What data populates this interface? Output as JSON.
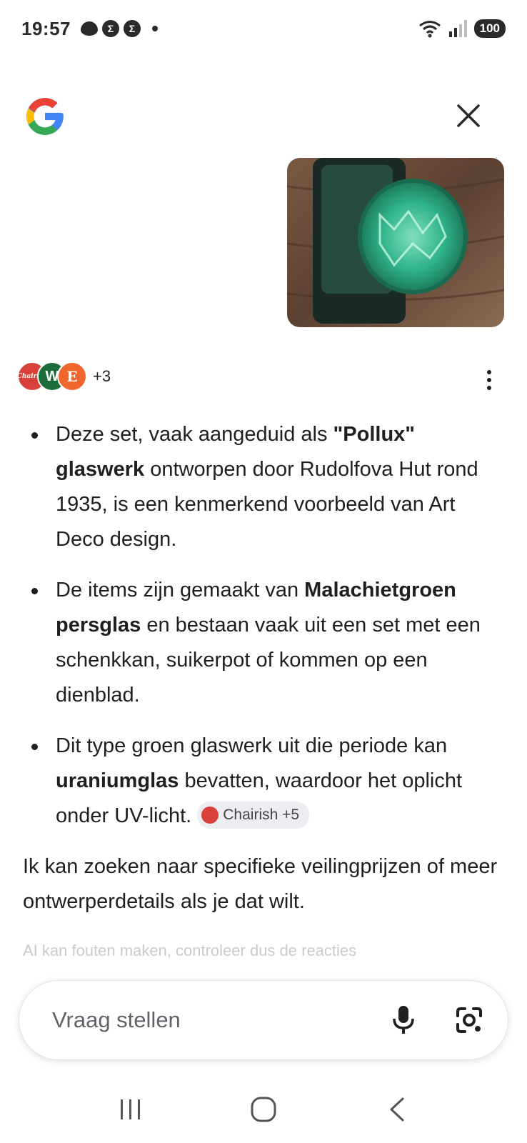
{
  "status_bar": {
    "time": "19:57",
    "battery": "100",
    "notif_badge_1": "Σ",
    "notif_badge_2": "Σ"
  },
  "header": {
    "logo_icon": "google-g-logo",
    "close_icon": "close-icon"
  },
  "attachment": {
    "icon": "photo-thumbnail",
    "description_colors": {
      "glass": "#2fb38a",
      "wood": "#6b4a33"
    }
  },
  "sources": {
    "avatars": [
      {
        "label": "Chairish",
        "color": "#d8413a"
      },
      {
        "label": "W",
        "color": "#1e6b3a"
      },
      {
        "label": "E",
        "color": "#f0662c"
      }
    ],
    "more_count": "+3"
  },
  "answer": {
    "bullet1": {
      "pre": "Deze set, vaak aangeduid als ",
      "bold": "\"Pollux\" glaswerk",
      "post": " ontworpen door Rudolfova Hut rond 1935, is een kenmerkend voorbeeld van Art Deco design."
    },
    "bullet2": {
      "pre": "De items zijn gemaakt van ",
      "bold": "Malachietgroen persglas",
      "post": " en bestaan vaak uit een set met een schenkkan, suikerpot of kommen op een dienblad."
    },
    "bullet3": {
      "pre": "Dit type groen glaswerk uit die periode kan ",
      "bold": "uraniumglas",
      "post": " bevatten, waardoor het oplicht onder UV-licht. "
    },
    "citation_chip": "Chairish +5",
    "follow_up": "Ik kan zoeken naar specifieke veilingprijzen of meer ontwerperdetails als je dat wilt."
  },
  "disclaimer": "AI kan fouten maken, controleer dus de reacties",
  "ask_bar": {
    "placeholder": "Vraag stellen",
    "mic_icon": "microphone-icon",
    "lens_icon": "camera-lens-icon"
  },
  "nav": {
    "recents_icon": "recent-apps-icon",
    "home_icon": "home-icon",
    "back_icon": "back-icon"
  }
}
